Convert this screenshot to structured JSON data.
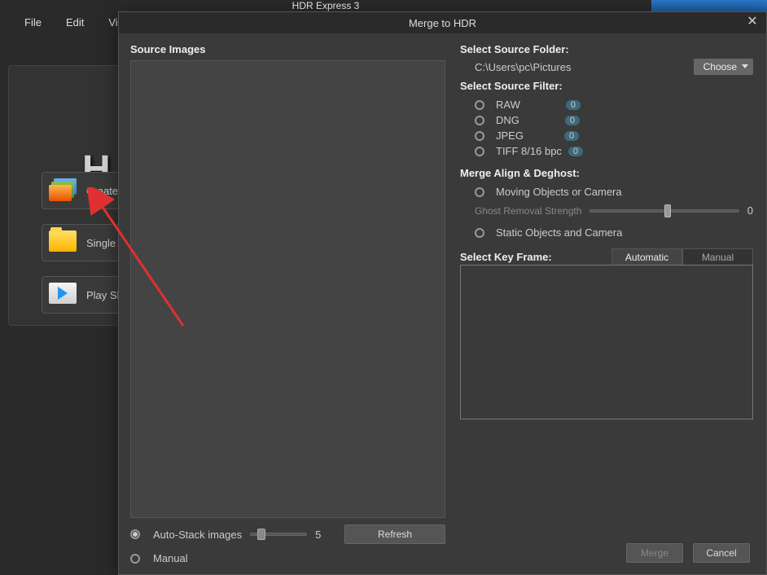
{
  "main": {
    "title": "HDR Express 3",
    "menu": [
      "File",
      "Edit",
      "Vi"
    ],
    "logo": "H",
    "modes": [
      {
        "label": "Create/M"
      },
      {
        "label": "Single In"
      },
      {
        "label": "Play Slid"
      }
    ]
  },
  "dialog": {
    "title": "Merge to HDR",
    "source_images_label": "Source Images",
    "auto_stack": {
      "label": "Auto-Stack images",
      "value": "5"
    },
    "manual_label": "Manual",
    "refresh_label": "Refresh",
    "source_folder": {
      "label": "Select Source Folder:",
      "path": "C:\\Users\\pc\\Pictures",
      "choose": "Choose"
    },
    "source_filter": {
      "label": "Select Source Filter:",
      "options": [
        {
          "name": "RAW",
          "count": "0"
        },
        {
          "name": "DNG",
          "count": "0"
        },
        {
          "name": "JPEG",
          "count": "0"
        },
        {
          "name": "TIFF 8/16 bpc",
          "count": "0"
        }
      ]
    },
    "merge_align": {
      "label": "Merge Align & Deghost:",
      "moving": "Moving Objects or Camera",
      "ghost_label": "Ghost Removal Strength",
      "ghost_value": "0",
      "static": "Static Objects and Camera"
    },
    "keyframe": {
      "label": "Select Key Frame:",
      "tabs": [
        "Automatic",
        "Manual"
      ]
    },
    "footer": {
      "merge": "Merge",
      "cancel": "Cancel"
    }
  }
}
